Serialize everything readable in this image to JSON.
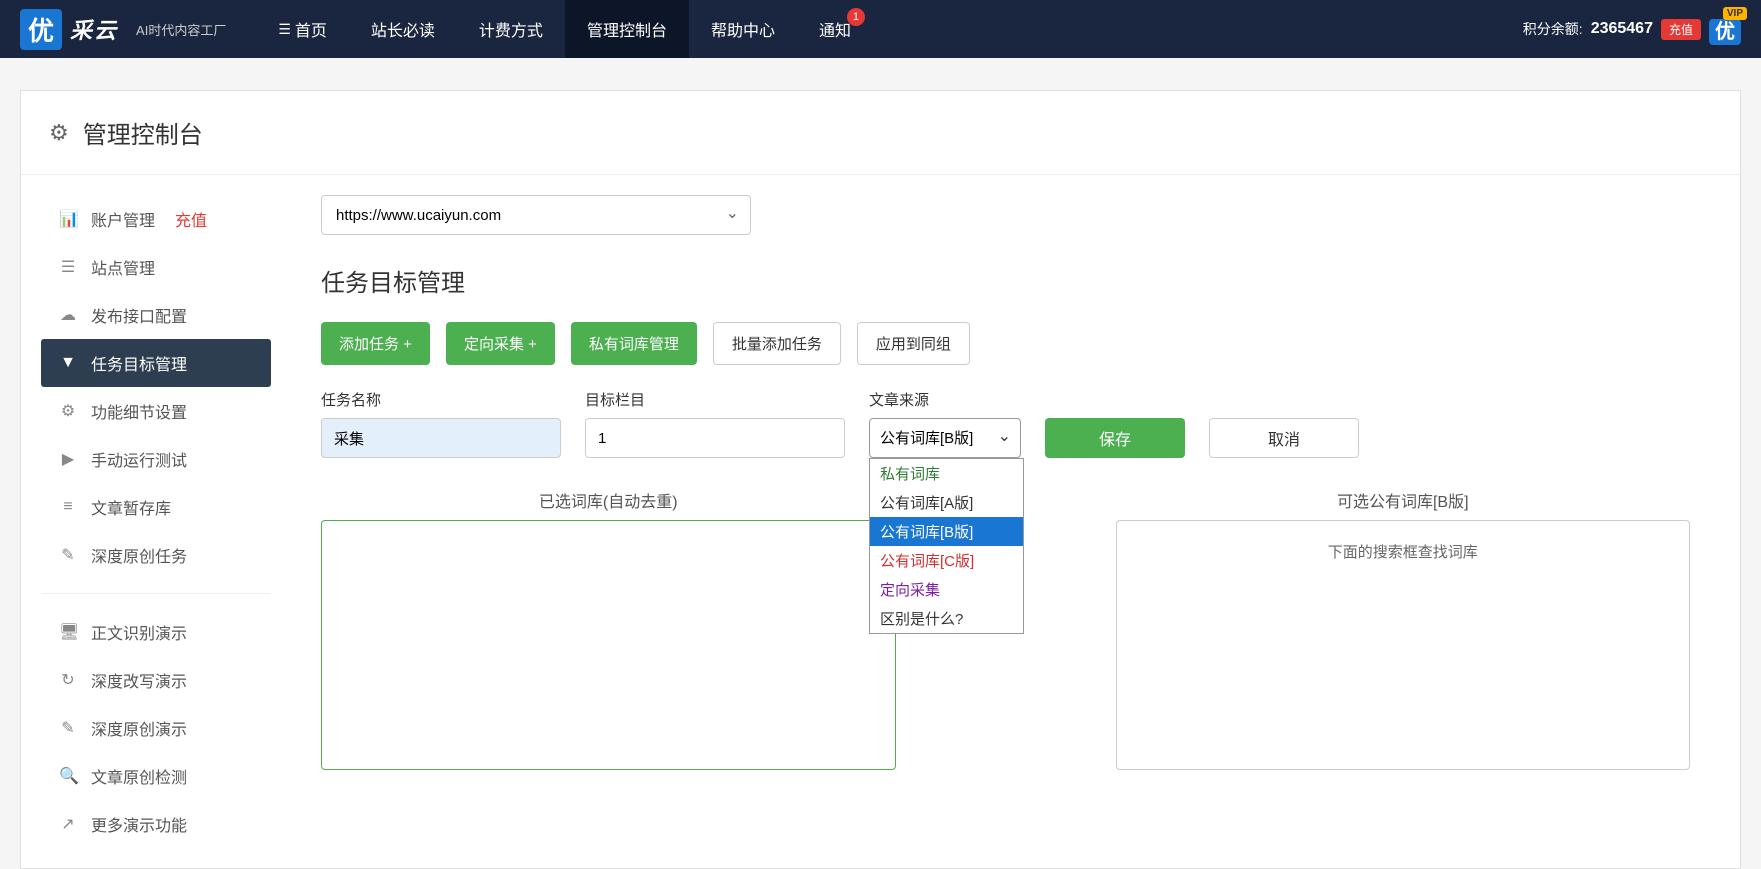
{
  "topnav": {
    "logo_text": "优",
    "logo_name": "采云",
    "subtitle": "AI时代内容工厂",
    "items": [
      "首页",
      "站长必读",
      "计费方式",
      "管理控制台",
      "帮助中心",
      "通知"
    ],
    "notif_count": "1",
    "points_label": "积分余额:",
    "points_value": "2365467",
    "recharge": "充值",
    "vip": "VIP"
  },
  "page": {
    "title": "管理控制台"
  },
  "sidebar": {
    "items": [
      {
        "label": "账户管理",
        "extra": "充值"
      },
      {
        "label": "站点管理"
      },
      {
        "label": "发布接口配置"
      },
      {
        "label": "任务目标管理"
      },
      {
        "label": "功能细节设置"
      },
      {
        "label": "手动运行测试"
      },
      {
        "label": "文章暂存库"
      },
      {
        "label": "深度原创任务"
      }
    ],
    "items2": [
      {
        "label": "正文识别演示"
      },
      {
        "label": "深度改写演示"
      },
      {
        "label": "深度原创演示"
      },
      {
        "label": "文章原创检测"
      },
      {
        "label": "更多演示功能"
      }
    ]
  },
  "main": {
    "url_selected": "https://www.ucaiyun.com",
    "section_title": "任务目标管理",
    "buttons": {
      "add_task": "添加任务 +",
      "direct_collect": "定向采集 +",
      "private_lib": "私有词库管理",
      "batch_add": "批量添加任务",
      "apply_group": "应用到同组"
    },
    "form": {
      "task_label": "任务名称",
      "task_value": "采集",
      "target_label": "目标栏目",
      "target_value": "1",
      "source_label": "文章来源",
      "source_value": "公有词库[B版]",
      "save": "保存",
      "cancel": "取消"
    },
    "dropdown": {
      "private": "私有词库",
      "a": "公有词库[A版]",
      "b": "公有词库[B版]",
      "c": "公有词库[C版]",
      "direct": "定向采集",
      "diff": "区别是什么?"
    },
    "lists": {
      "selected_title": "已选词库(自动去重)",
      "available_title": "可选公有词库[B版]",
      "available_hint": "下面的搜索框查找词库"
    }
  }
}
